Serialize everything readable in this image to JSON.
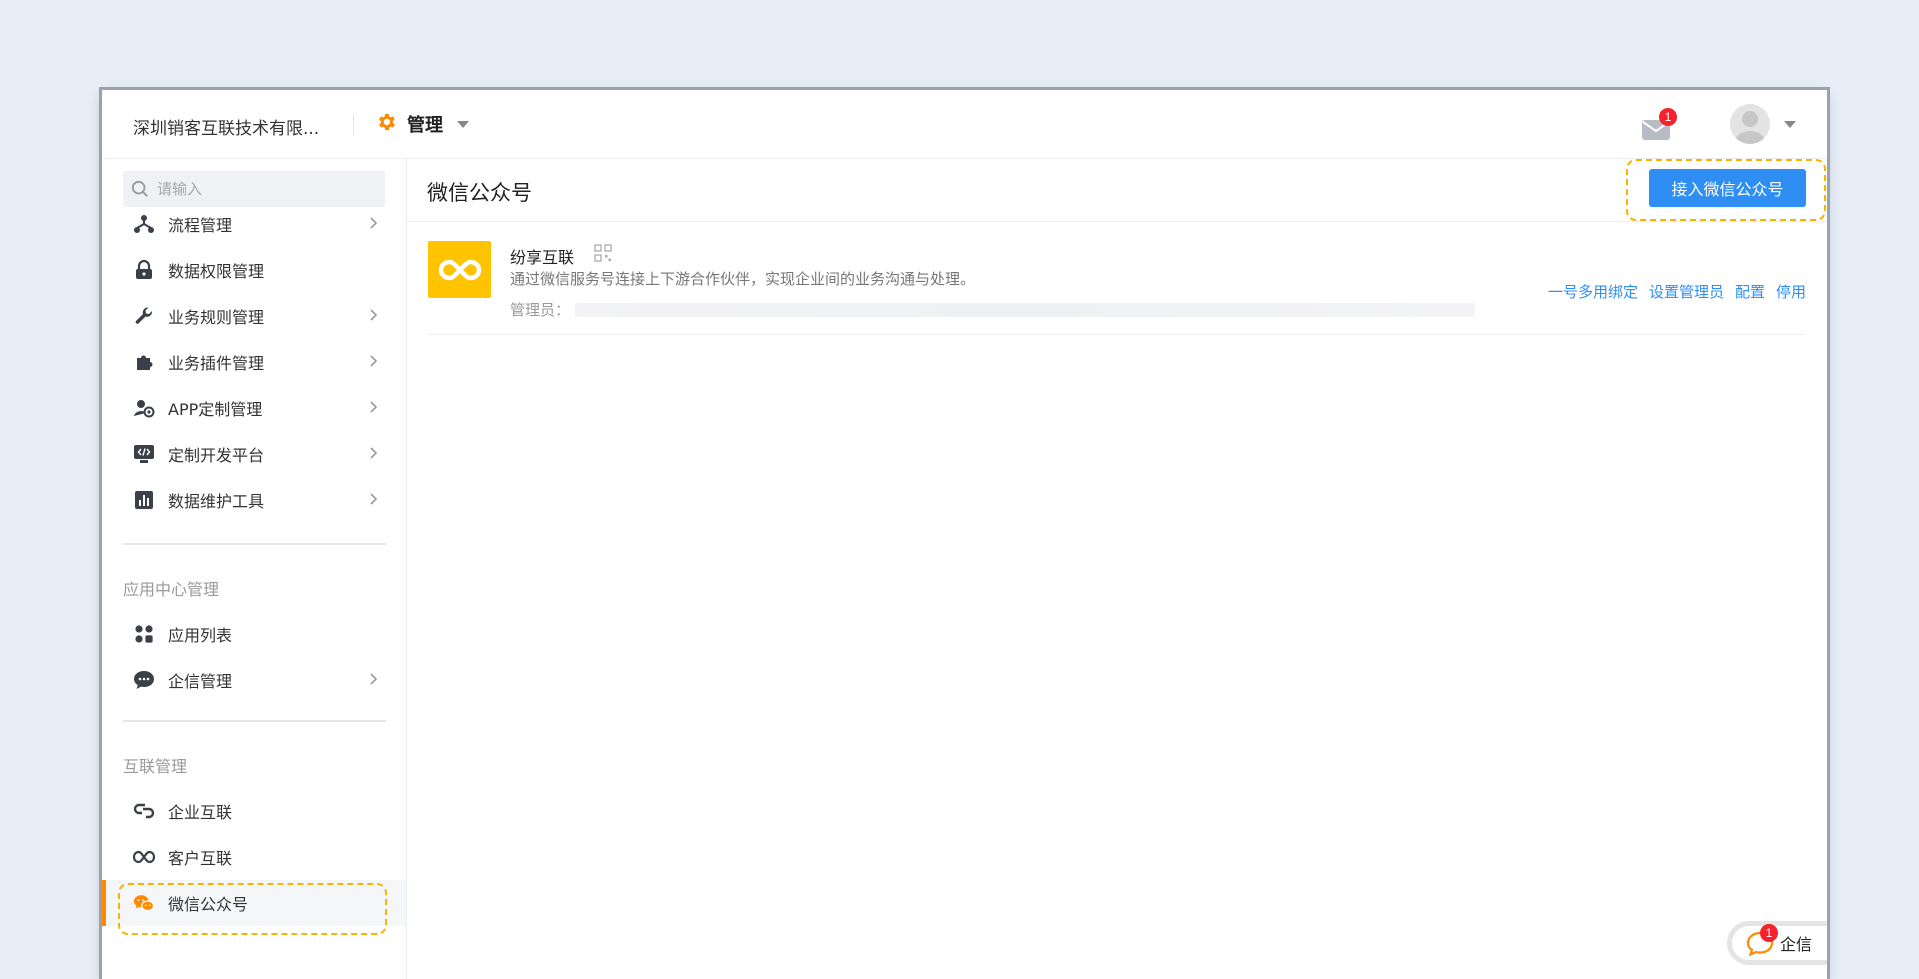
{
  "header": {
    "company": "深圳销客互联技术有限...",
    "module": "管理",
    "mail_badge": "1"
  },
  "sidebar": {
    "search_placeholder": "请输入",
    "items": [
      {
        "label": "流程管理",
        "icon": "flow-icon",
        "has_arrow": true
      },
      {
        "label": "数据权限管理",
        "icon": "lock-icon",
        "has_arrow": false
      },
      {
        "label": "业务规则管理",
        "icon": "wrench-icon",
        "has_arrow": true
      },
      {
        "label": "业务插件管理",
        "icon": "puzzle-icon",
        "has_arrow": true
      },
      {
        "label": "APP定制管理",
        "icon": "app-custom-icon",
        "has_arrow": true
      },
      {
        "label": "定制开发平台",
        "icon": "code-monitor-icon",
        "has_arrow": true
      },
      {
        "label": "数据维护工具",
        "icon": "bar-chart-icon",
        "has_arrow": true
      }
    ],
    "section_app": "应用中心管理",
    "app_items": [
      {
        "label": "应用列表",
        "icon": "grid-icon",
        "has_arrow": false
      },
      {
        "label": "企信管理",
        "icon": "chat-icon",
        "has_arrow": true
      }
    ],
    "section_interconnect": "互联管理",
    "interconnect_items": [
      {
        "label": "企业互联",
        "icon": "link-icon",
        "has_arrow": false
      },
      {
        "label": "客户互联",
        "icon": "infinity-icon",
        "has_arrow": false
      },
      {
        "label": "微信公众号",
        "icon": "wechat-icon",
        "has_arrow": false,
        "active": true
      }
    ]
  },
  "main": {
    "title": "微信公众号",
    "connect_button": "接入微信公众号",
    "account": {
      "name": "纷享互联",
      "description": "通过微信服务号连接上下游合作伙伴，实现企业间的业务沟通与处理。",
      "admin_label": "管理员：",
      "actions": [
        "一号多用绑定",
        "设置管理员",
        "配置",
        "停用"
      ]
    }
  },
  "chat_widget": {
    "label": "企信",
    "badge": "1"
  },
  "colors": {
    "accent": "#2f8ef4",
    "highlight": "#f7b500",
    "active_bar": "#ff8a00",
    "logo_bg": "#ffc300"
  }
}
